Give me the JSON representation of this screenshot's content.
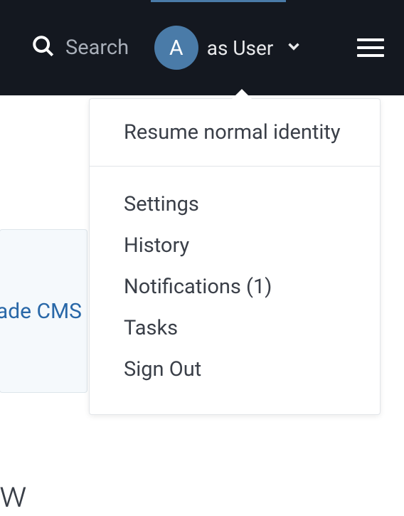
{
  "topbar": {
    "search_label": "Search",
    "avatar_initial": "A",
    "as_user_label": "as User"
  },
  "info_box": {
    "text": "ade CMS"
  },
  "heading": {
    "text": "ew"
  },
  "dropdown": {
    "resume_identity": "Resume normal identity",
    "items": [
      {
        "label": "Settings"
      },
      {
        "label": "History"
      },
      {
        "label": "Notifications (1)"
      },
      {
        "label": "Tasks"
      },
      {
        "label": "Sign Out"
      }
    ]
  }
}
